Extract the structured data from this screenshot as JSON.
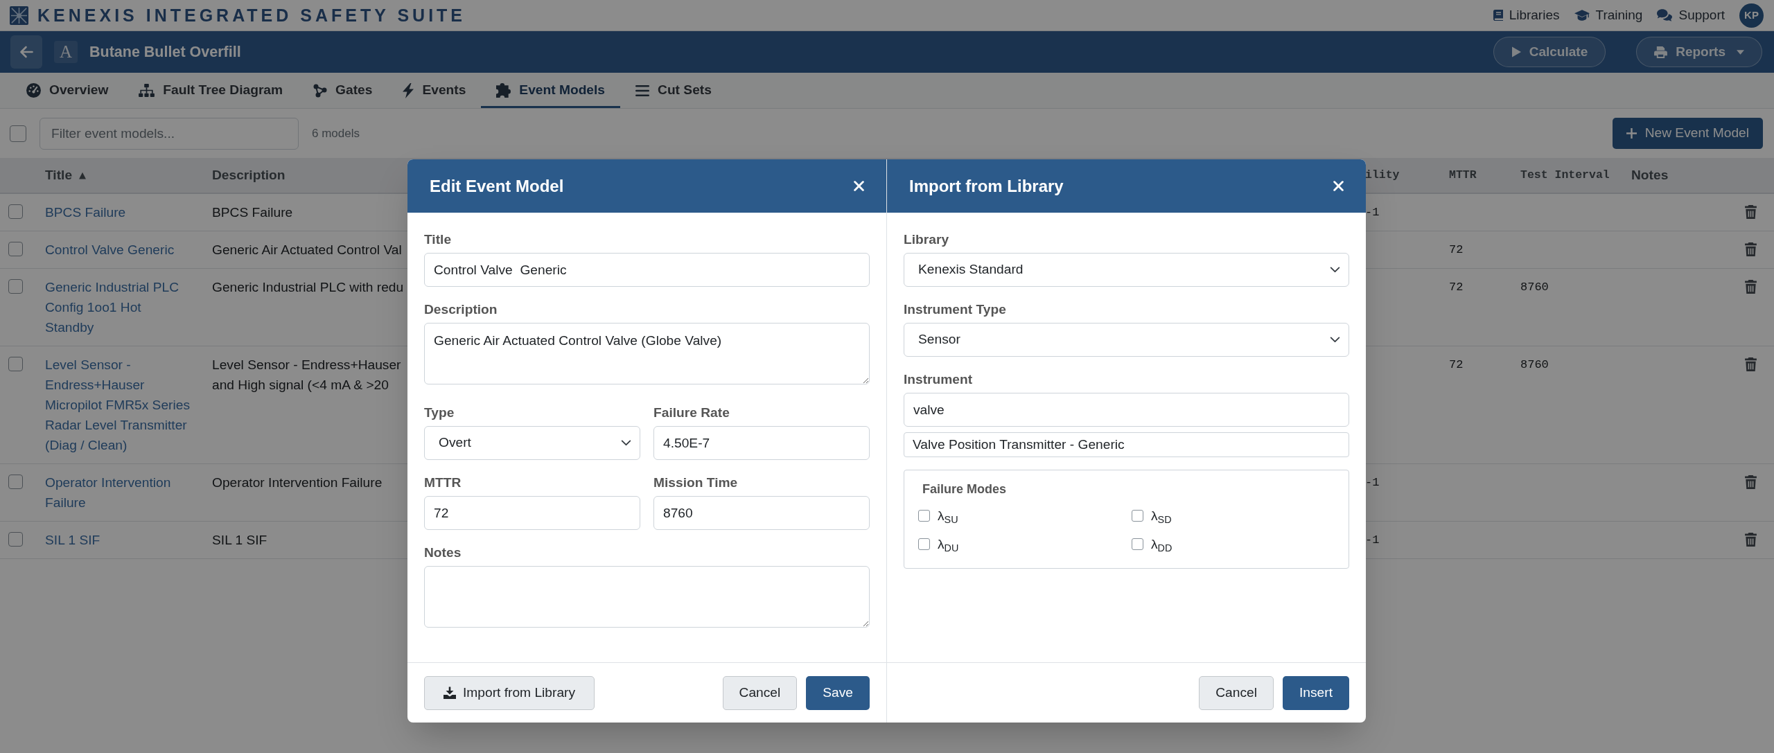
{
  "header": {
    "logo": "KENEXIS INTEGRATED SAFETY SUITE",
    "links": [
      {
        "label": "Libraries"
      },
      {
        "label": "Training"
      },
      {
        "label": "Support"
      }
    ],
    "avatar": "KP"
  },
  "project_bar": {
    "badge": "A",
    "title": "Butane Bullet Overfill",
    "buttons": [
      {
        "label": "Calculate",
        "dropdown": false
      },
      {
        "label": "Reports",
        "dropdown": true
      }
    ]
  },
  "tabs": [
    {
      "label": "Overview",
      "selected": false
    },
    {
      "label": "Fault Tree Diagram",
      "selected": false
    },
    {
      "label": "Gates",
      "selected": false
    },
    {
      "label": "Events",
      "selected": false
    },
    {
      "label": "Event Models",
      "selected": true
    },
    {
      "label": "Cut Sets",
      "selected": false
    }
  ],
  "toolbar": {
    "select_all": {
      "checked": false
    },
    "filter": {
      "placeholder": "Filter event models..."
    },
    "count": "6 models",
    "new_button": {
      "label": "New Event Model"
    }
  },
  "table": {
    "columns": [
      {
        "label": "Title",
        "kind": "text",
        "sort_indicator": "▲"
      },
      {
        "label": "Description",
        "kind": "text"
      },
      {
        "label": "ility",
        "kind": "numeric"
      },
      {
        "label": "MTTR",
        "kind": "numeric"
      },
      {
        "label": "Test Interval",
        "kind": "numeric"
      },
      {
        "label": "Notes",
        "kind": "text"
      }
    ],
    "rows": [
      {
        "checked": false,
        "cells": [
          "BPCS Failure",
          "BPCS Failure",
          "-1",
          null,
          null,
          null
        ]
      },
      {
        "checked": false,
        "cells": [
          "Control Valve Generic",
          "Generic Air Actuated Control Val",
          null,
          "72",
          null,
          null
        ]
      },
      {
        "checked": false,
        "cells": [
          "Generic Industrial PLC Config 1oo1 Hot Standby",
          "Generic Industrial PLC with redu",
          null,
          "72",
          "8760",
          null
        ]
      },
      {
        "checked": false,
        "cells": [
          "Level Sensor - Endress+Hauser Micropilot FMR5x Series Radar Level Transmitter (Diag / Clean)",
          "Level Sensor - Endress+Hauser\nand High signal (<4 mA & >20",
          null,
          "72",
          "8760",
          null
        ]
      },
      {
        "checked": false,
        "cells": [
          "Operator Intervention Failure",
          "Operator Intervention Failure",
          "-1",
          null,
          null,
          null
        ]
      },
      {
        "checked": false,
        "cells": [
          "SIL 1 SIF",
          "SIL 1 SIF",
          "-1",
          null,
          null,
          null
        ]
      }
    ]
  },
  "edit_dialog": {
    "title": "Edit Event Model",
    "fields": [
      {
        "label": "Title",
        "kind": "text",
        "value": "Control Valve  Generic"
      },
      {
        "label": "Description",
        "kind": "textarea",
        "value": "Generic Air Actuated Control Valve (Globe Valve)"
      },
      {
        "label": "Type",
        "kind": "select",
        "value": "Overt"
      },
      {
        "label": "Failure Rate",
        "kind": "text",
        "value": "4.50E-7"
      },
      {
        "label": "MTTR",
        "kind": "text",
        "value": "72"
      },
      {
        "label": "Mission Time",
        "kind": "text",
        "value": "8760"
      },
      {
        "label": "Notes",
        "kind": "textarea"
      }
    ],
    "buttons": [
      {
        "label": "Import from Library",
        "kind": "import"
      },
      {
        "label": "Cancel",
        "kind": "secondary"
      },
      {
        "label": "Save",
        "kind": "primary"
      }
    ]
  },
  "import_dialog": {
    "title": "Import from Library",
    "fields": [
      {
        "label": "Library",
        "kind": "select",
        "value": "Kenexis Standard"
      },
      {
        "label": "Instrument Type",
        "kind": "select",
        "value": "Sensor"
      },
      {
        "label": "Instrument",
        "kind": "text",
        "value": "valve",
        "suggestions": [
          "Valve Position Transmitter - Generic"
        ]
      }
    ],
    "failure_modes": {
      "legend": "Failure Modes",
      "options": [
        {
          "label": "λ$_{SU}$",
          "checked": false
        },
        {
          "label": "λ$_{SD}$",
          "checked": false
        },
        {
          "label": "λ$_{DU}$",
          "checked": false
        },
        {
          "label": "λ$_{DD}$",
          "checked": false
        }
      ]
    },
    "buttons": [
      {
        "label": "Cancel",
        "kind": "secondary"
      },
      {
        "label": "Insert",
        "kind": "primary"
      }
    ]
  }
}
